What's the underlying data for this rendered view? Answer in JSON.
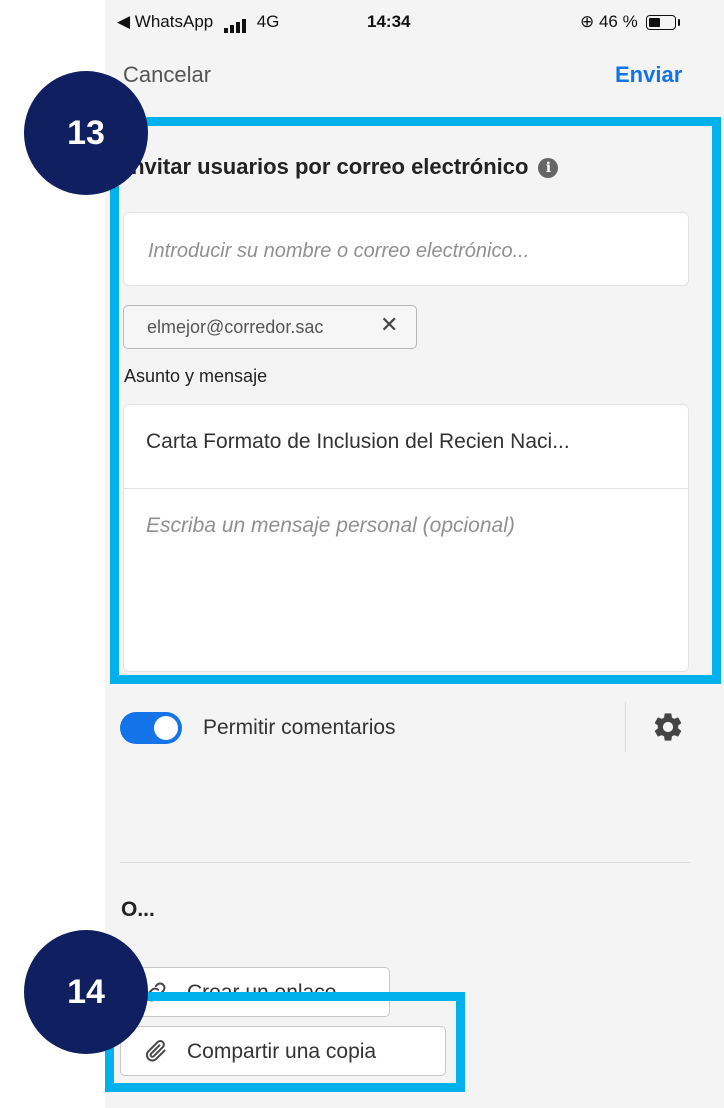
{
  "status_bar": {
    "back_app": "◀ WhatsApp",
    "network": "4G",
    "time": "14:34",
    "battery": "⊕ 46 %"
  },
  "nav": {
    "cancel": "Cancelar",
    "send": "Enviar"
  },
  "invite": {
    "title": "Invitar usuarios por correo electrónico",
    "email_placeholder": "Introducir su nombre o correo electrónico...",
    "recipients": [
      "elmejor@corredor.sac"
    ],
    "subject_label": "Asunto y mensaje",
    "subject_value": "Carta Formato de Inclusion del Recien Naci...",
    "message_placeholder": "Escriba un mensaje personal (opcional)"
  },
  "comments": {
    "label": "Permitir comentarios",
    "enabled": true
  },
  "alternatives": {
    "heading": "O...",
    "create_link": "Crear un enlace",
    "share_copy": "Compartir una copia"
  },
  "tutorial": {
    "step_13": "13",
    "step_14": "14",
    "highlight_color": "#00b1ec",
    "badge_color": "#0f1f60"
  },
  "colors": {
    "accent": "#1473e6",
    "background": "#f4f4f4"
  }
}
